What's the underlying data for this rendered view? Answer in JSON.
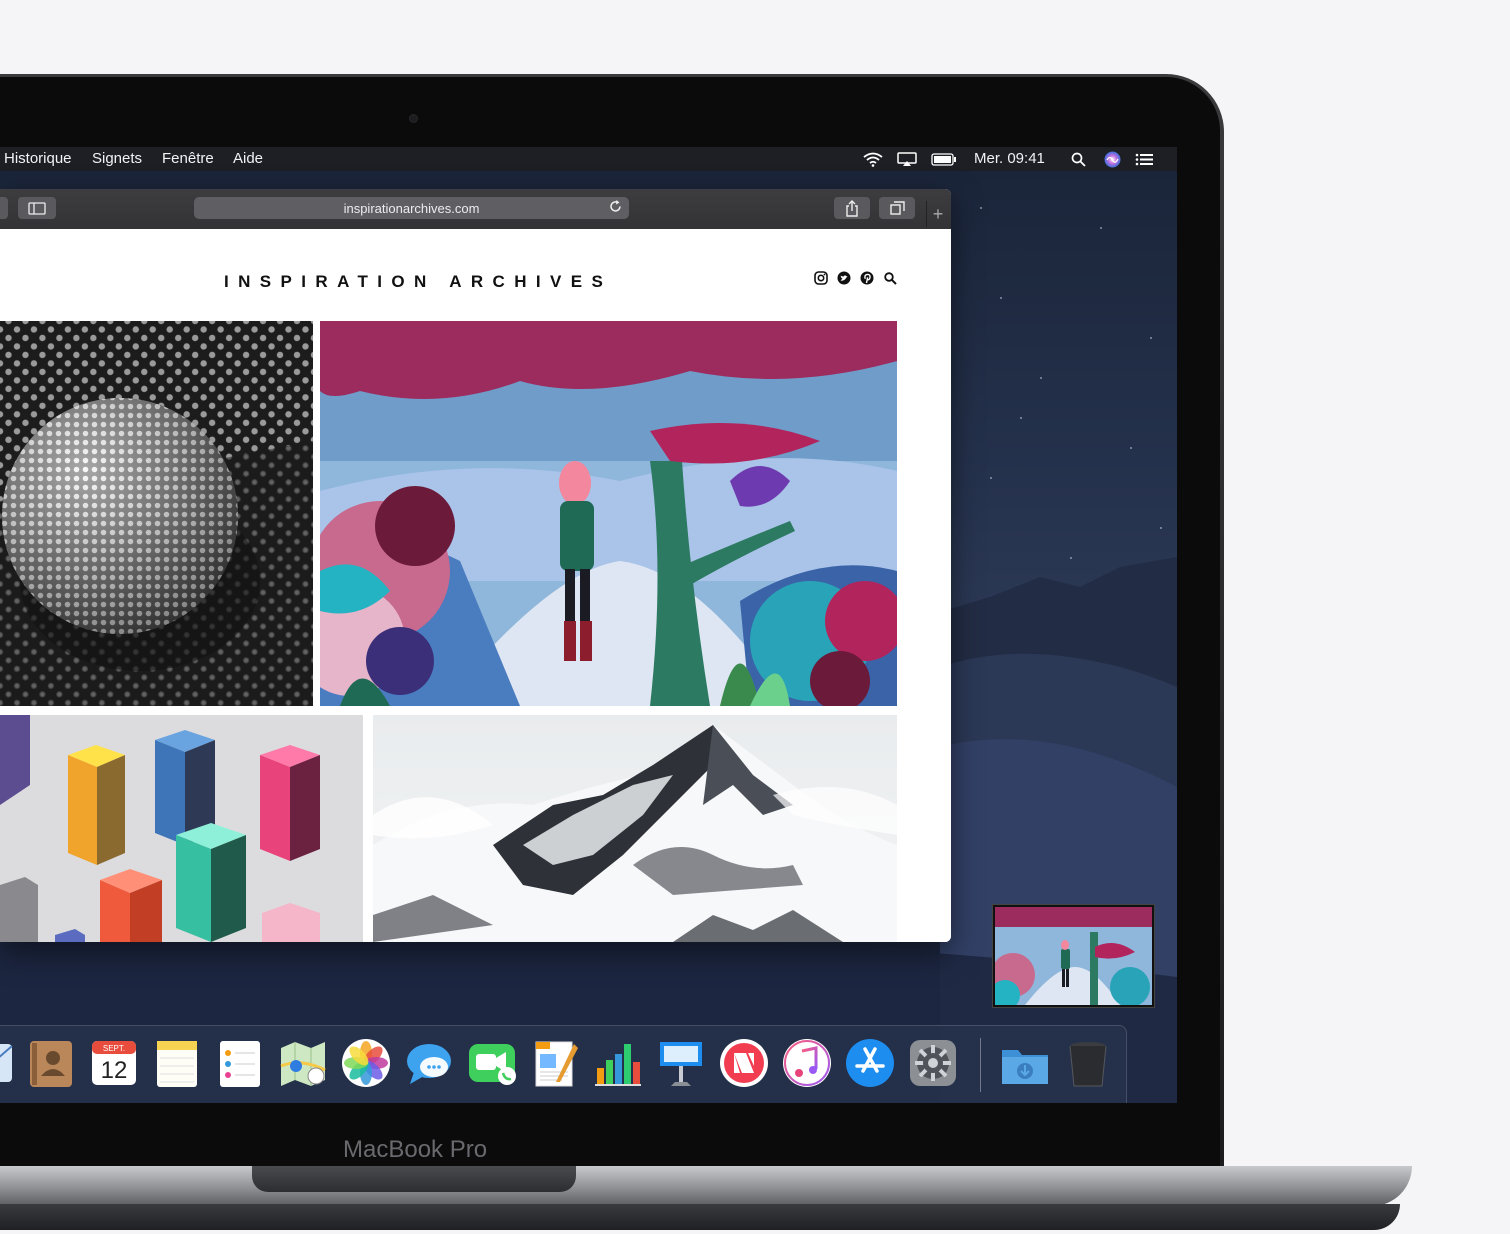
{
  "menubar": {
    "items": [
      "Historique",
      "Signets",
      "Fenêtre",
      "Aide"
    ],
    "clock": "Mer. 09:41"
  },
  "browser": {
    "url": "inspirationarchives.com",
    "new_tab": "+"
  },
  "site": {
    "title": "INSPIRATION ARCHIVES"
  },
  "dock": {
    "calendar_month": "SEPT.",
    "calendar_day": "12"
  },
  "device": {
    "label": "MacBook Pro"
  },
  "colors": {
    "accent_pink": "#b2245c",
    "forest_green": "#2d7a62",
    "sky_blue": "#8fb6db"
  }
}
